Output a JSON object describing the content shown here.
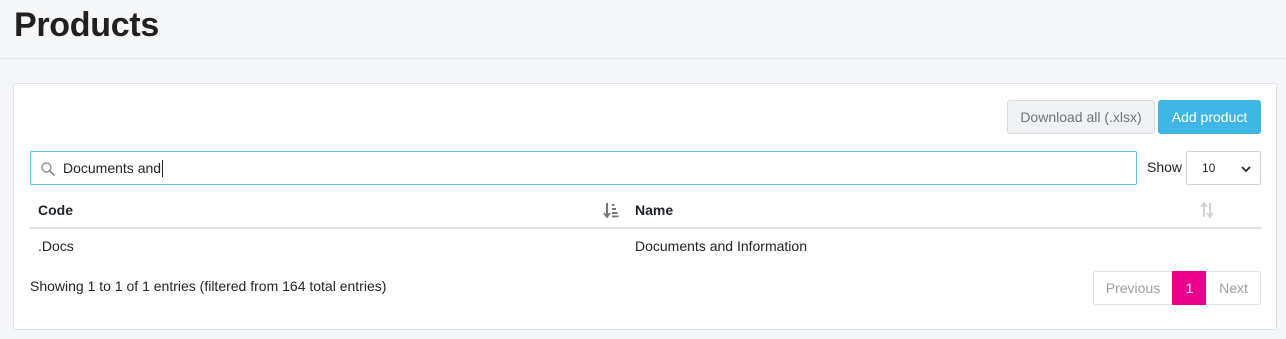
{
  "header": {
    "title": "Products"
  },
  "toolbar": {
    "download_label": "Download all (.xlsx)",
    "add_label": "Add product"
  },
  "search": {
    "value": "Documents and",
    "icon": "search-icon"
  },
  "length": {
    "label": "Show",
    "selected": "10"
  },
  "table": {
    "columns": [
      {
        "label": "Code",
        "sort_icon": "sort-amount-down-icon"
      },
      {
        "label": "Name",
        "sort_icon": "sort-both-icon"
      }
    ],
    "rows": [
      {
        "code": ".Docs",
        "name": "Documents and Information"
      }
    ]
  },
  "footer": {
    "info": "Showing 1 to 1 of 1 entries (filtered from 164 total entries)",
    "previous": "Previous",
    "current_page": "1",
    "next": "Next"
  },
  "colors": {
    "accent": "#3fb6e3",
    "active_page": "#ec008c",
    "search_border": "#5bc0de"
  }
}
